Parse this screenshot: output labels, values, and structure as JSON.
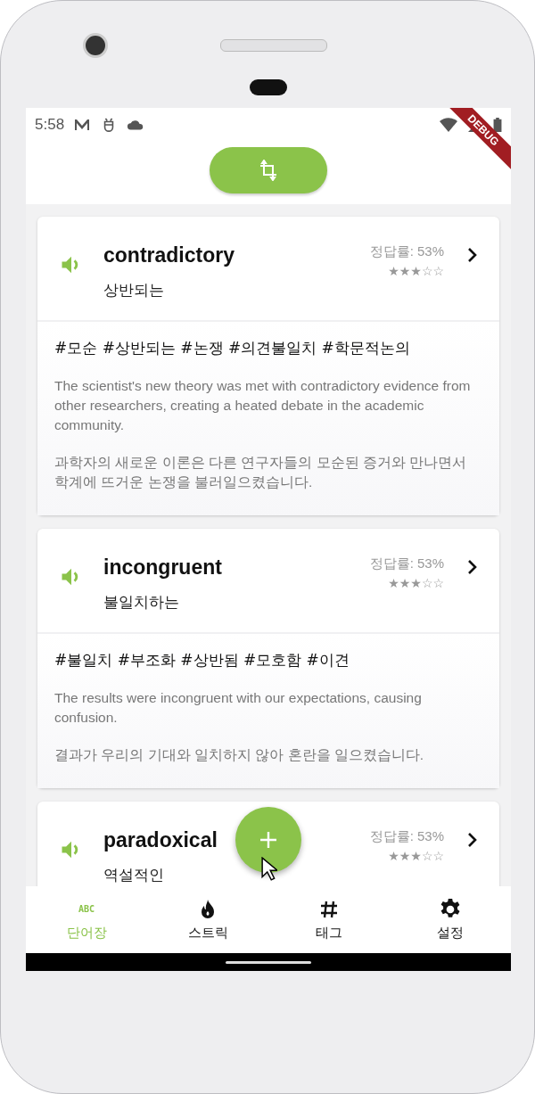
{
  "status_bar": {
    "time": "5:58"
  },
  "debug_banner": "DEBUG",
  "words": [
    {
      "word": "contradictory",
      "meaning": "상반되는",
      "accuracy": "정답률: 53%",
      "stars": 3,
      "tags": "#모순 #상반되는 #논쟁 #의견불일치 #학문적논의",
      "example": "The scientist's new theory was met with contradictory evidence from other researchers, creating a heated debate in the academic community.",
      "translation": "과학자의 새로운 이론은 다른 연구자들의 모순된 증거와 만나면서 학계에 뜨거운 논쟁을 불러일으켰습니다."
    },
    {
      "word": "incongruent",
      "meaning": "불일치하는",
      "accuracy": "정답률: 53%",
      "stars": 3,
      "tags": "#불일치 #부조화 #상반됨 #모호함 #이견",
      "example": "The results were incongruent with our expectations, causing confusion.",
      "translation": "결과가 우리의 기대와 일치하지 않아 혼란을 일으켰습니다."
    },
    {
      "word": "paradoxical",
      "meaning": "역설적인",
      "accuracy": "정답률: 53%",
      "stars": 3
    }
  ],
  "nav": [
    {
      "kind": "abc",
      "icon_text": "ABC",
      "label": "단어장",
      "selected": true
    },
    {
      "kind": "fire",
      "label": "스트릭",
      "selected": false
    },
    {
      "kind": "hash",
      "label": "태그",
      "selected": false
    },
    {
      "kind": "gear",
      "label": "설정",
      "selected": false
    }
  ]
}
